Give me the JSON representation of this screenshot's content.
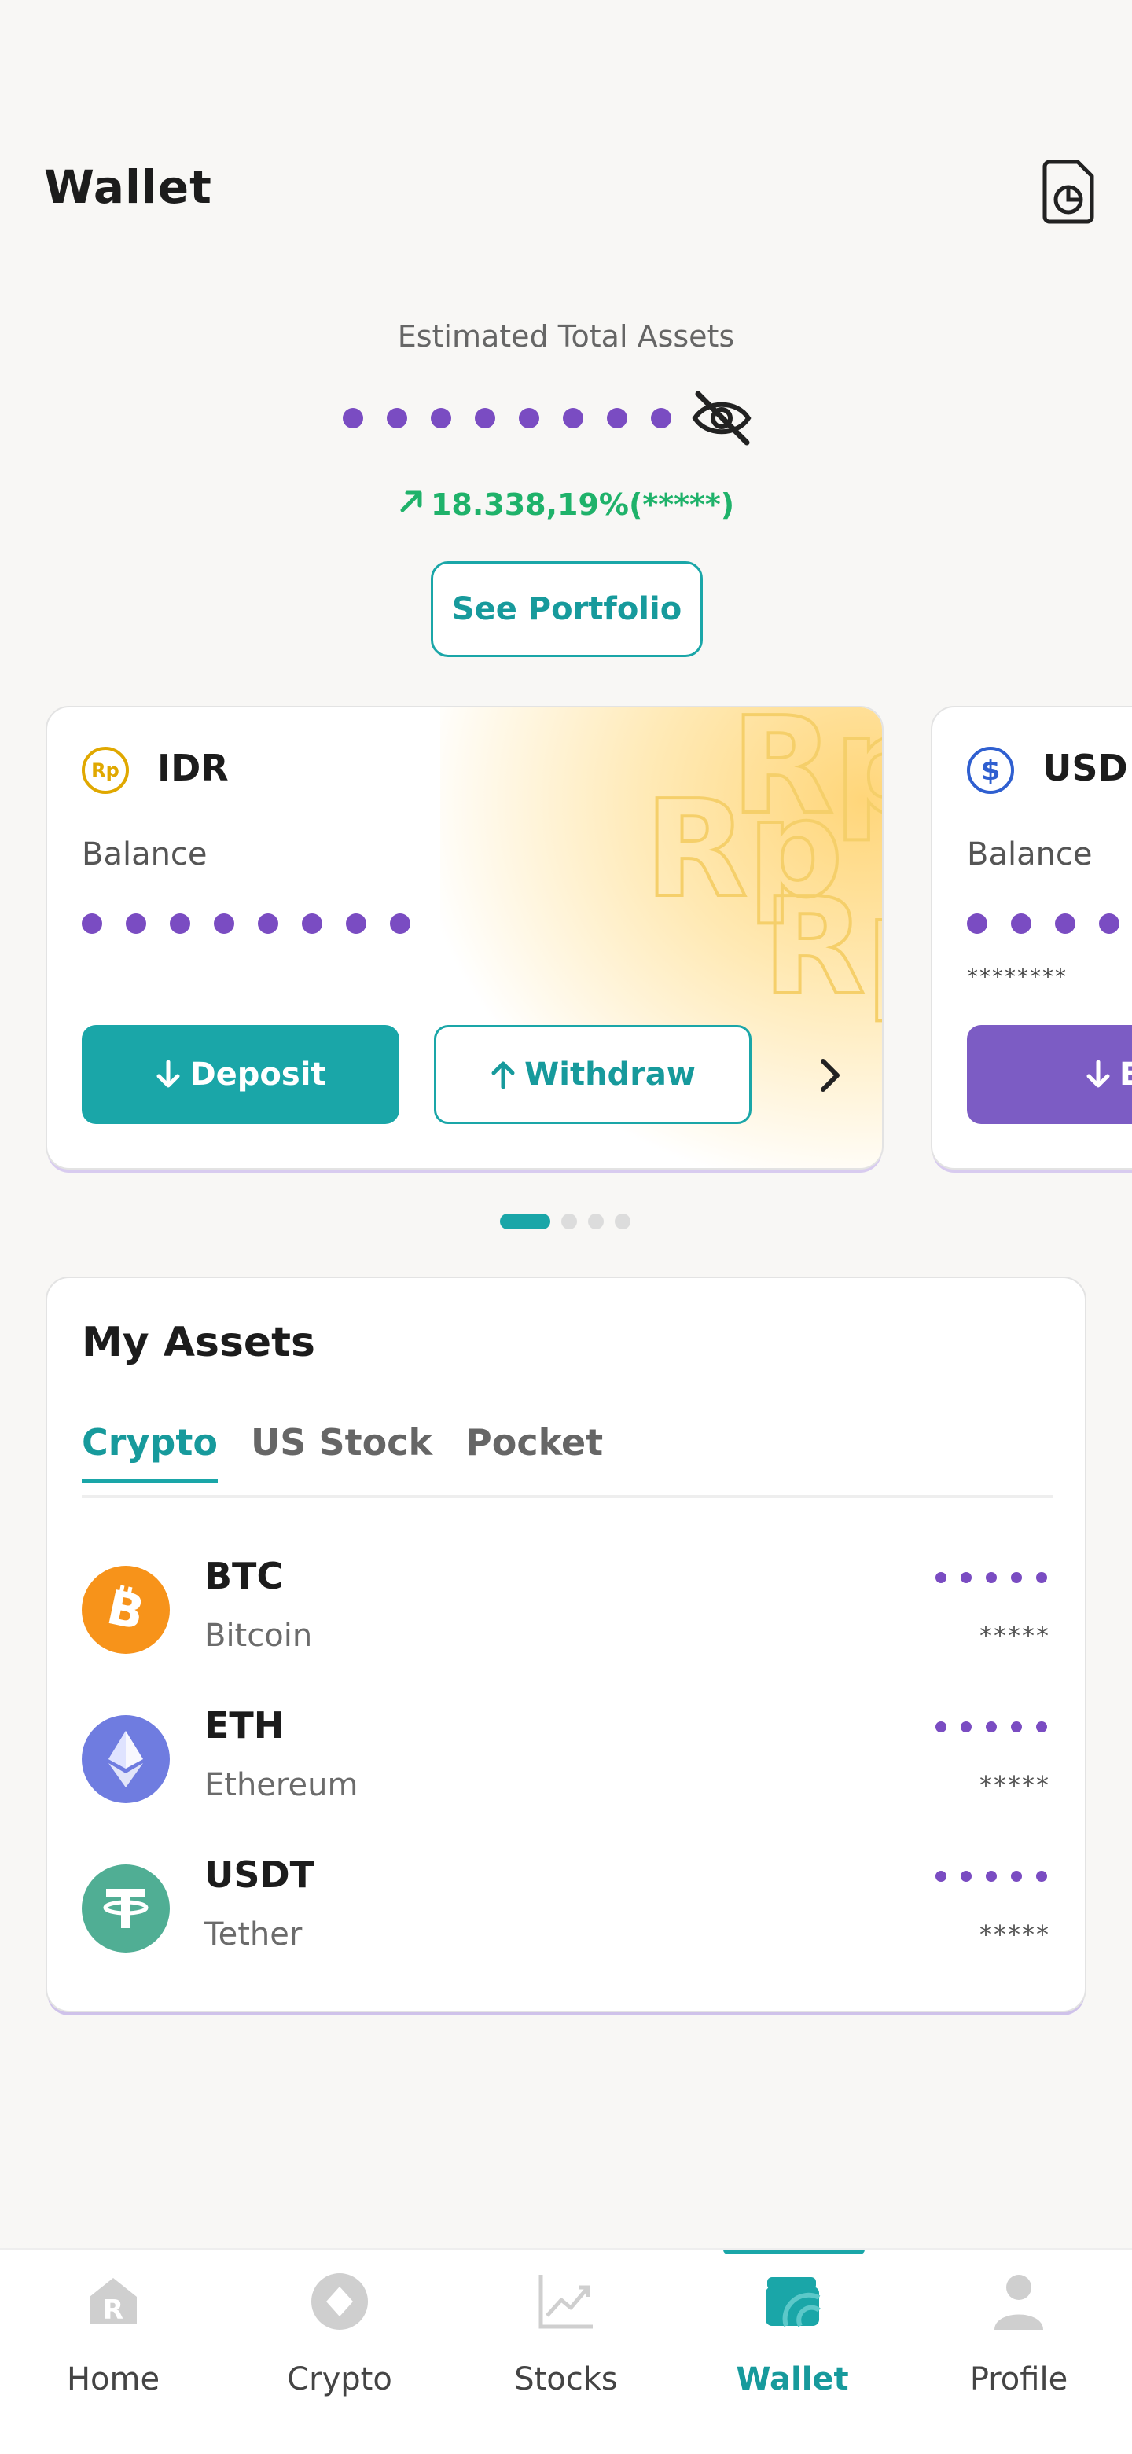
{
  "header": {
    "title": "Wallet",
    "report_icon": "file-chart-icon"
  },
  "summary": {
    "label": "Estimated Total Assets",
    "masked_dots": 8,
    "visibility_icon": "eye-off-icon",
    "change_text": "18.338,19%(*****)",
    "change_color": "#1fb26a",
    "portfolio_button": "See Portfolio"
  },
  "currency_cards": [
    {
      "currency": "IDR",
      "icon_text": "Rp",
      "balance_label": "Balance",
      "masked_dots": 8,
      "watermark": "Rp",
      "deposit_label": "Deposit",
      "withdraw_label": "Withdraw"
    },
    {
      "currency": "USD",
      "icon_text": "$",
      "balance_label": "Balance",
      "masked_dots": 4,
      "masked_stars": "********",
      "button_label": "E"
    }
  ],
  "pager": {
    "count": 4,
    "active": 0
  },
  "assets": {
    "title": "My Assets",
    "tabs": [
      "Crypto",
      "US Stock",
      "Pocket"
    ],
    "active_tab": 0,
    "items": [
      {
        "symbol": "BTC",
        "name": "Bitcoin",
        "masked_amount": "*****",
        "color": "#f7931a",
        "icon": "bitcoin-icon"
      },
      {
        "symbol": "ETH",
        "name": "Ethereum",
        "masked_amount": "*****",
        "color": "#6f7ce0",
        "icon": "ethereum-icon"
      },
      {
        "symbol": "USDT",
        "name": "Tether",
        "masked_amount": "*****",
        "color": "#50ae94",
        "icon": "tether-icon"
      }
    ]
  },
  "nav": {
    "items": [
      {
        "label": "Home",
        "icon": "home-icon"
      },
      {
        "label": "Crypto",
        "icon": "crypto-icon"
      },
      {
        "label": "Stocks",
        "icon": "stocks-chart-icon"
      },
      {
        "label": "Wallet",
        "icon": "wallet-icon"
      },
      {
        "label": "Profile",
        "icon": "profile-icon"
      }
    ],
    "active": 3
  },
  "colors": {
    "accent": "#1aa6a8",
    "mask": "#7a4cc2",
    "usd_button": "#7c5cc4"
  }
}
